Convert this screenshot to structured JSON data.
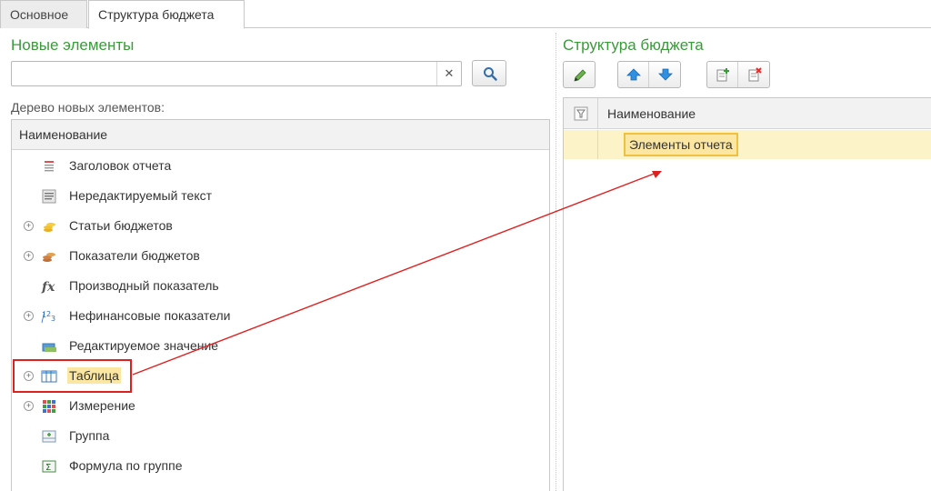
{
  "tabs": [
    {
      "label": "Основное"
    },
    {
      "label": "Структура бюджета"
    }
  ],
  "left": {
    "title": "Новые элементы",
    "search": {
      "value": "",
      "placeholder": ""
    },
    "tree_caption": "Дерево новых элементов:",
    "column_header": "Наименование",
    "items": [
      {
        "label": "Заголовок отчета",
        "icon": "report-header-icon",
        "expandable": false
      },
      {
        "label": "Нередактируемый текст",
        "icon": "text-block-icon",
        "expandable": false
      },
      {
        "label": "Статьи бюджетов",
        "icon": "coins-icon",
        "expandable": true
      },
      {
        "label": "Показатели бюджетов",
        "icon": "indicator-coins-icon",
        "expandable": true
      },
      {
        "label": "Производный показатель",
        "icon": "function-fx-icon",
        "expandable": false
      },
      {
        "label": "Нефинансовые показатели",
        "icon": "numeric-123-icon",
        "expandable": true
      },
      {
        "label": "Редактируемое значение",
        "icon": "editable-value-icon",
        "expandable": false
      },
      {
        "label": "Таблица",
        "icon": "table-icon",
        "expandable": true,
        "selected": true
      },
      {
        "label": "Измерение",
        "icon": "dimension-grid-icon",
        "expandable": true
      },
      {
        "label": "Группа",
        "icon": "group-icon",
        "expandable": false
      },
      {
        "label": "Формула по группе",
        "icon": "sum-formula-icon",
        "expandable": false
      }
    ]
  },
  "right": {
    "title": "Структура бюджета",
    "toolbar": [
      "edit-pencil-icon",
      "move-up-icon",
      "move-down-icon",
      "add-element-icon",
      "delete-element-icon"
    ],
    "column_header": "Наименование",
    "rows": [
      {
        "label": "Элементы отчета"
      }
    ]
  },
  "colors": {
    "title_green": "#3a9b3a",
    "selection_yellow": "#fbe6a2",
    "selection_border": "#f0c040",
    "annotation_red": "#e02020",
    "toolbar_blue": "#2f8fe0"
  }
}
